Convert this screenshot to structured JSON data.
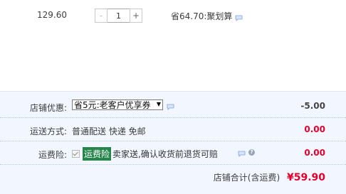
{
  "item": {
    "unit_price": "129.60",
    "quantity": "1",
    "minus_label": "-",
    "plus_label": "+",
    "saving_text": "省64.70:聚划算",
    "message_icon": "message-icon"
  },
  "shop_discount": {
    "label": "店铺优惠:",
    "selected_option": "省5元:老客户优享券",
    "value": "-5.00"
  },
  "shipping": {
    "label": "运送方式:",
    "method": "普通配送 快递 免邮",
    "value": "0.00"
  },
  "freight_insurance": {
    "label": "运费险:",
    "tag": "运费险",
    "desc": "卖家送,确认收货前退货可赔",
    "value": "0.00",
    "checked": true
  },
  "total": {
    "label": "店铺合计(含运费)",
    "value": "¥59.90"
  },
  "colors": {
    "accent_red": "#e4002b",
    "panel_bg": "#f2f7ff",
    "tag_green": "#26854a"
  }
}
